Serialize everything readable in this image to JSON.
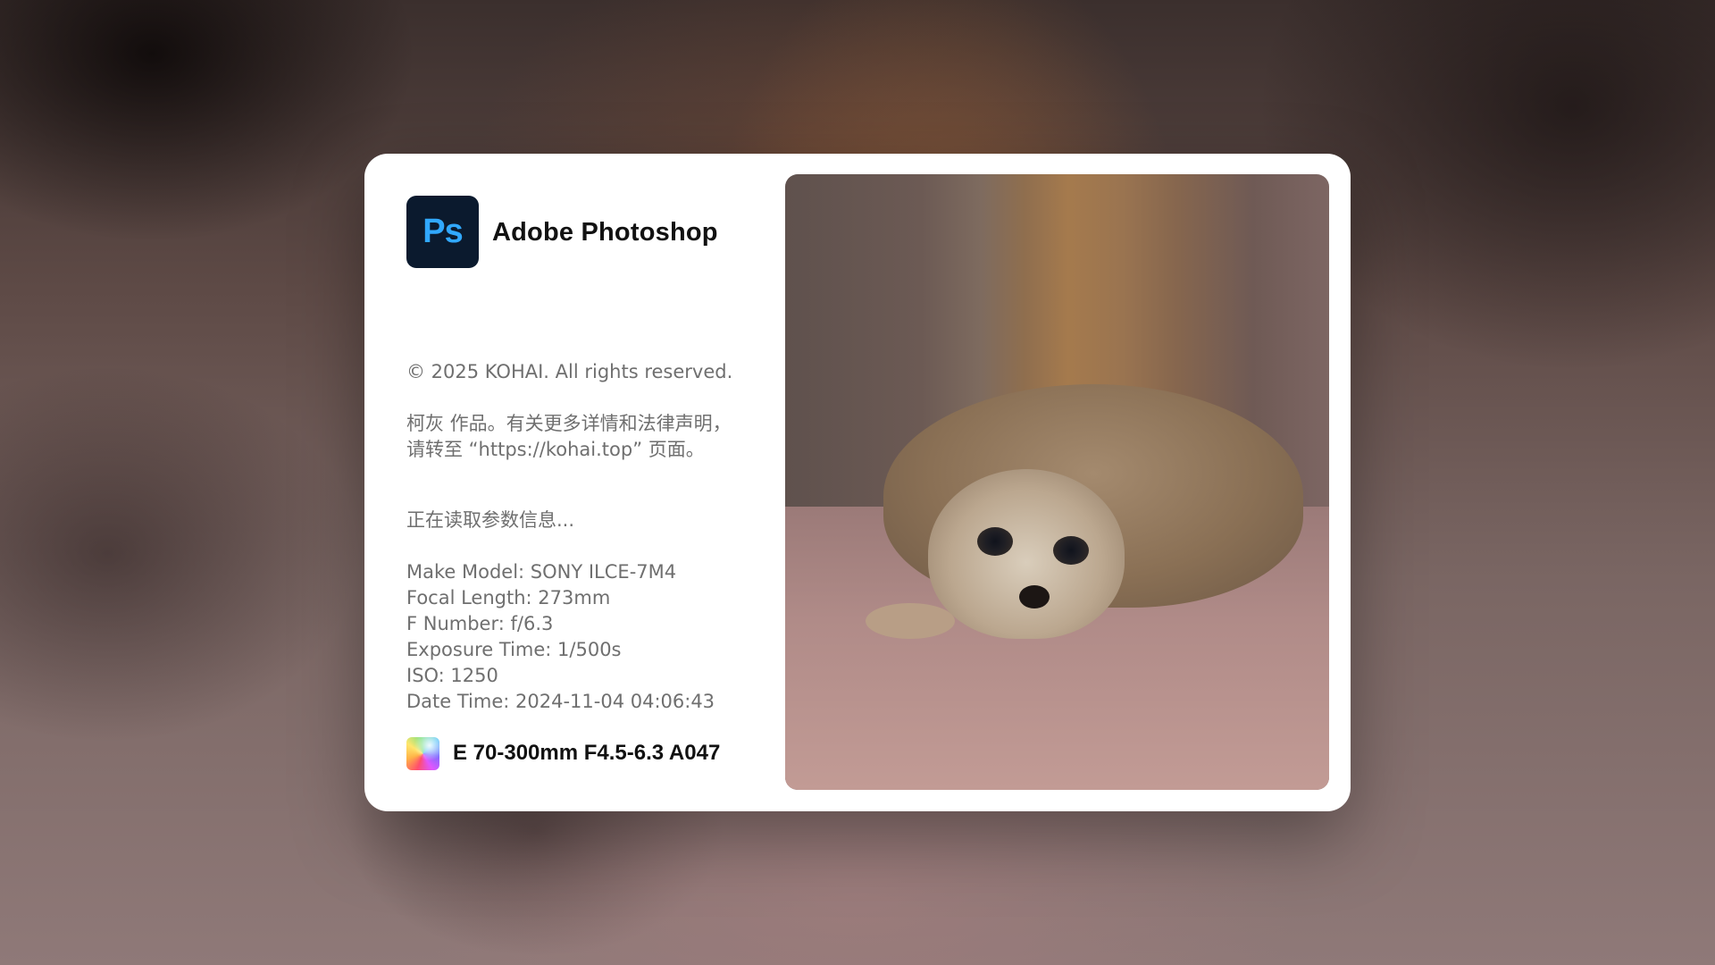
{
  "app": {
    "icon_label": "Ps",
    "name": "Adobe Photoshop"
  },
  "copyright": "© 2025 KOHAI. All rights reserved.",
  "legal": {
    "line1": "柯灰 作品。有关更多详情和法律声明，",
    "line2": "请转至 “https://kohai.top” 页面。"
  },
  "loading_status": "正在读取参数信息...",
  "exif": {
    "make_model": "Make Model: SONY ILCE-7M4",
    "focal_length": "Focal Length: 273mm",
    "f_number": "F Number: f/6.3",
    "exposure_time": "Exposure Time: 1/500s",
    "iso": "ISO: 1250",
    "date_time": "Date Time: 2024-11-04 04:06:43"
  },
  "lens": {
    "icon": "gradient-lens-icon",
    "label": "E 70-300mm F4.5-6.3 A047"
  },
  "colors": {
    "ps_icon_bg": "#0b1a2e",
    "ps_icon_text": "#31a8ff",
    "dialog_bg": "#ffffff",
    "muted_text": "#6f6f6f"
  }
}
